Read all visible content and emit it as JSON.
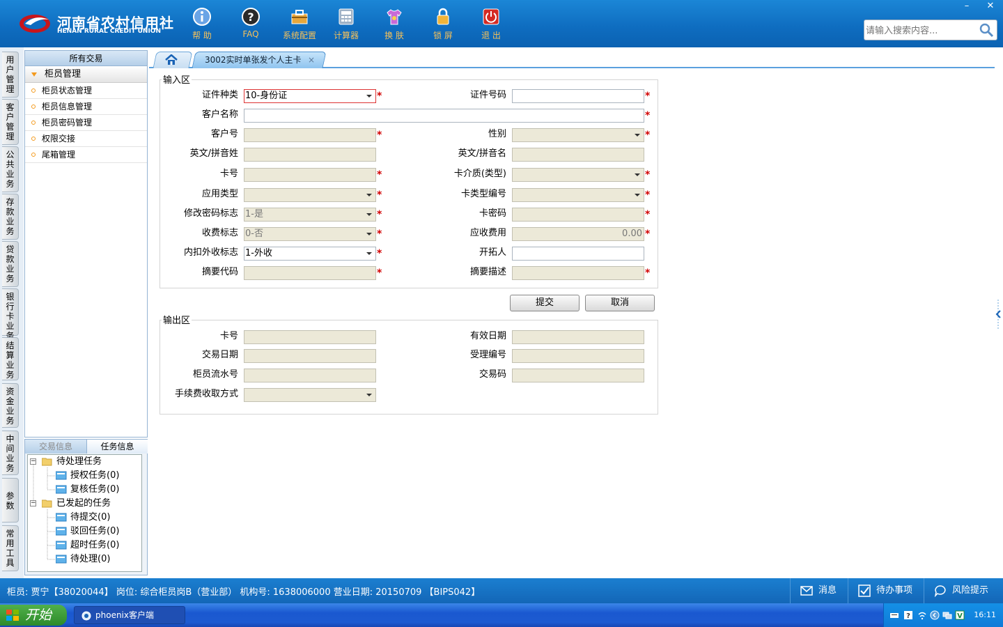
{
  "header": {
    "logo_cn": "河南省农村信用社",
    "logo_en": "HENAN RURAL CREDIT UNION",
    "tools": [
      {
        "label": "帮 助",
        "icon": "info-icon"
      },
      {
        "label": "FAQ",
        "icon": "question-icon"
      },
      {
        "label": "系统配置",
        "icon": "toolbox-icon"
      },
      {
        "label": "计算器",
        "icon": "calculator-icon"
      },
      {
        "label": "换 肤",
        "icon": "shirt-icon"
      },
      {
        "label": "锁 屏",
        "icon": "lock-icon"
      },
      {
        "label": "退 出",
        "icon": "power-icon"
      }
    ],
    "search_placeholder": "请输入搜索内容...",
    "window_controls": [
      "–",
      "✕"
    ]
  },
  "side_tabs": [
    "用户管理",
    "客户管理",
    "公共业务",
    "存款业务",
    "贷款业务",
    "银行卡业务",
    "结算业务",
    "资金业务",
    "中间业务",
    "参数",
    "常用工具"
  ],
  "nav": {
    "header": "所有交易",
    "group": "柜员管理",
    "items": [
      "柜员状态管理",
      "柜员信息管理",
      "柜员密码管理",
      "权限交接",
      "尾箱管理"
    ]
  },
  "tasks": {
    "tabs": [
      "交易信息",
      "任务信息"
    ],
    "active_tab": "任务信息",
    "tree": {
      "pending": "待处理任务",
      "pending_children": [
        "授权任务(0)",
        "复核任务(0)"
      ],
      "initiated": "已发起的任务",
      "initiated_children": [
        "待提交(0)",
        "驳回任务(0)",
        "超时任务(0)",
        "待处理(0)"
      ]
    }
  },
  "tab": {
    "active_title": "3002实时单张发个人主卡",
    "close": "×"
  },
  "form": {
    "input_section": "输入区",
    "output_section": "输出区",
    "labels": {
      "id_type": "证件种类",
      "id_no": "证件号码",
      "cust_name": "客户名称",
      "cust_no": "客户号",
      "gender": "性别",
      "en_surname": "英文/拼音姓",
      "en_name": "英文/拼音名",
      "card_no": "卡号",
      "card_medium": "卡介质(类型)",
      "app_type": "应用类型",
      "card_type_no": "卡类型编号",
      "chg_pwd_flag": "修改密码标志",
      "card_pwd": "卡密码",
      "fee_flag": "收费标志",
      "fee_due": "应收费用",
      "inner_outer_flag": "内扣外收标志",
      "developer": "开拓人",
      "summary_code": "摘要代码",
      "summary_desc": "摘要描述"
    },
    "values": {
      "id_type": "10-身份证",
      "chg_pwd_flag": "1-是",
      "fee_flag": "0-否",
      "fee_due": "0.00",
      "inner_outer_flag": "1-外收"
    },
    "required_mark": "*",
    "submit": "提交",
    "cancel": "取消",
    "output_labels": {
      "card_no": "卡号",
      "valid_date": "有效日期",
      "trans_date": "交易日期",
      "accept_no": "受理编号",
      "teller_serial": "柜员流水号",
      "trans_code": "交易码",
      "fee_method": "手续费收取方式"
    }
  },
  "status": {
    "text": "柜员: 贾宁【38020044】 岗位: 综合柜员岗B（营业部） 机构号: 1638006000  营业日期: 20150709 【BIPS042】",
    "buttons": [
      {
        "label": "消息",
        "icon": "mail-icon"
      },
      {
        "label": "待办事项",
        "icon": "checkbox-icon"
      },
      {
        "label": "风险提示",
        "icon": "chat-icon"
      }
    ]
  },
  "taskbar": {
    "start": "开始",
    "item": "phoenix客户端",
    "clock": "16:11"
  },
  "colors": {
    "brand_blue": "#0e6cbf",
    "accent_orange": "#f39a1e",
    "required_red": "#d10000",
    "readonly_bg": "#ece9d8"
  }
}
